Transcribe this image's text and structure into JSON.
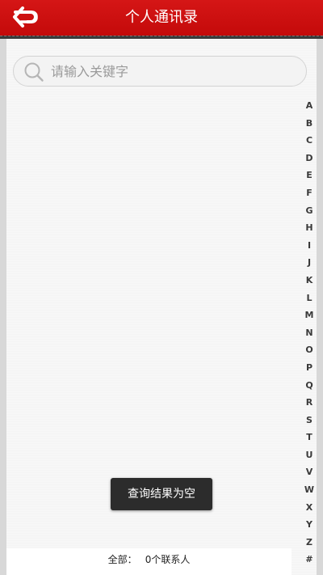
{
  "header": {
    "title": "个人通讯录",
    "back_icon": "back-arrow-icon",
    "background_color": "#c90d0d"
  },
  "search": {
    "placeholder": "请输入关键字",
    "value": "",
    "icon": "search-icon"
  },
  "index_bar": {
    "letters": [
      "A",
      "B",
      "C",
      "D",
      "E",
      "F",
      "G",
      "H",
      "I",
      "J",
      "K",
      "L",
      "M",
      "N",
      "O",
      "P",
      "Q",
      "R",
      "S",
      "T",
      "U",
      "V",
      "W",
      "X",
      "Y",
      "Z",
      "#"
    ]
  },
  "footer": {
    "label": "全部：",
    "count_text": "0个联系人"
  },
  "toast": {
    "message": "查询结果为空"
  }
}
